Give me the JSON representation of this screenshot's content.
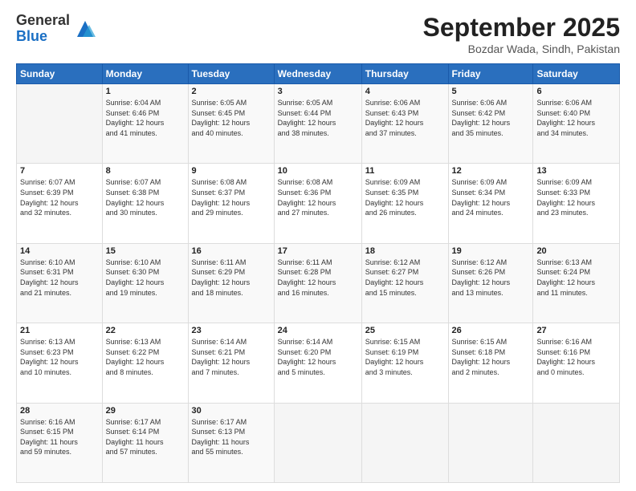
{
  "logo": {
    "general": "General",
    "blue": "Blue"
  },
  "title": "September 2025",
  "location": "Bozdar Wada, Sindh, Pakistan",
  "days_of_week": [
    "Sunday",
    "Monday",
    "Tuesday",
    "Wednesday",
    "Thursday",
    "Friday",
    "Saturday"
  ],
  "weeks": [
    [
      {
        "day": "",
        "info": ""
      },
      {
        "day": "1",
        "info": "Sunrise: 6:04 AM\nSunset: 6:46 PM\nDaylight: 12 hours\nand 41 minutes."
      },
      {
        "day": "2",
        "info": "Sunrise: 6:05 AM\nSunset: 6:45 PM\nDaylight: 12 hours\nand 40 minutes."
      },
      {
        "day": "3",
        "info": "Sunrise: 6:05 AM\nSunset: 6:44 PM\nDaylight: 12 hours\nand 38 minutes."
      },
      {
        "day": "4",
        "info": "Sunrise: 6:06 AM\nSunset: 6:43 PM\nDaylight: 12 hours\nand 37 minutes."
      },
      {
        "day": "5",
        "info": "Sunrise: 6:06 AM\nSunset: 6:42 PM\nDaylight: 12 hours\nand 35 minutes."
      },
      {
        "day": "6",
        "info": "Sunrise: 6:06 AM\nSunset: 6:40 PM\nDaylight: 12 hours\nand 34 minutes."
      }
    ],
    [
      {
        "day": "7",
        "info": "Sunrise: 6:07 AM\nSunset: 6:39 PM\nDaylight: 12 hours\nand 32 minutes."
      },
      {
        "day": "8",
        "info": "Sunrise: 6:07 AM\nSunset: 6:38 PM\nDaylight: 12 hours\nand 30 minutes."
      },
      {
        "day": "9",
        "info": "Sunrise: 6:08 AM\nSunset: 6:37 PM\nDaylight: 12 hours\nand 29 minutes."
      },
      {
        "day": "10",
        "info": "Sunrise: 6:08 AM\nSunset: 6:36 PM\nDaylight: 12 hours\nand 27 minutes."
      },
      {
        "day": "11",
        "info": "Sunrise: 6:09 AM\nSunset: 6:35 PM\nDaylight: 12 hours\nand 26 minutes."
      },
      {
        "day": "12",
        "info": "Sunrise: 6:09 AM\nSunset: 6:34 PM\nDaylight: 12 hours\nand 24 minutes."
      },
      {
        "day": "13",
        "info": "Sunrise: 6:09 AM\nSunset: 6:33 PM\nDaylight: 12 hours\nand 23 minutes."
      }
    ],
    [
      {
        "day": "14",
        "info": "Sunrise: 6:10 AM\nSunset: 6:31 PM\nDaylight: 12 hours\nand 21 minutes."
      },
      {
        "day": "15",
        "info": "Sunrise: 6:10 AM\nSunset: 6:30 PM\nDaylight: 12 hours\nand 19 minutes."
      },
      {
        "day": "16",
        "info": "Sunrise: 6:11 AM\nSunset: 6:29 PM\nDaylight: 12 hours\nand 18 minutes."
      },
      {
        "day": "17",
        "info": "Sunrise: 6:11 AM\nSunset: 6:28 PM\nDaylight: 12 hours\nand 16 minutes."
      },
      {
        "day": "18",
        "info": "Sunrise: 6:12 AM\nSunset: 6:27 PM\nDaylight: 12 hours\nand 15 minutes."
      },
      {
        "day": "19",
        "info": "Sunrise: 6:12 AM\nSunset: 6:26 PM\nDaylight: 12 hours\nand 13 minutes."
      },
      {
        "day": "20",
        "info": "Sunrise: 6:13 AM\nSunset: 6:24 PM\nDaylight: 12 hours\nand 11 minutes."
      }
    ],
    [
      {
        "day": "21",
        "info": "Sunrise: 6:13 AM\nSunset: 6:23 PM\nDaylight: 12 hours\nand 10 minutes."
      },
      {
        "day": "22",
        "info": "Sunrise: 6:13 AM\nSunset: 6:22 PM\nDaylight: 12 hours\nand 8 minutes."
      },
      {
        "day": "23",
        "info": "Sunrise: 6:14 AM\nSunset: 6:21 PM\nDaylight: 12 hours\nand 7 minutes."
      },
      {
        "day": "24",
        "info": "Sunrise: 6:14 AM\nSunset: 6:20 PM\nDaylight: 12 hours\nand 5 minutes."
      },
      {
        "day": "25",
        "info": "Sunrise: 6:15 AM\nSunset: 6:19 PM\nDaylight: 12 hours\nand 3 minutes."
      },
      {
        "day": "26",
        "info": "Sunrise: 6:15 AM\nSunset: 6:18 PM\nDaylight: 12 hours\nand 2 minutes."
      },
      {
        "day": "27",
        "info": "Sunrise: 6:16 AM\nSunset: 6:16 PM\nDaylight: 12 hours\nand 0 minutes."
      }
    ],
    [
      {
        "day": "28",
        "info": "Sunrise: 6:16 AM\nSunset: 6:15 PM\nDaylight: 11 hours\nand 59 minutes."
      },
      {
        "day": "29",
        "info": "Sunrise: 6:17 AM\nSunset: 6:14 PM\nDaylight: 11 hours\nand 57 minutes."
      },
      {
        "day": "30",
        "info": "Sunrise: 6:17 AM\nSunset: 6:13 PM\nDaylight: 11 hours\nand 55 minutes."
      },
      {
        "day": "",
        "info": ""
      },
      {
        "day": "",
        "info": ""
      },
      {
        "day": "",
        "info": ""
      },
      {
        "day": "",
        "info": ""
      }
    ]
  ]
}
